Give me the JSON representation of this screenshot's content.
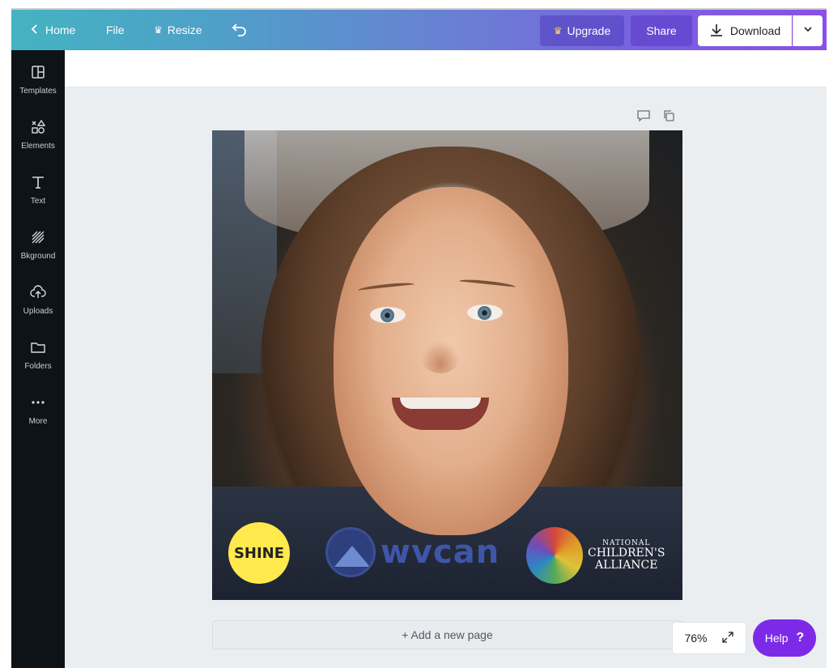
{
  "topbar": {
    "home_label": "Home",
    "file_label": "File",
    "resize_label": "Resize",
    "upgrade_label": "Upgrade",
    "share_label": "Share",
    "download_label": "Download"
  },
  "sidebar": {
    "items": [
      {
        "label": "Templates",
        "icon": "templates-icon"
      },
      {
        "label": "Elements",
        "icon": "elements-icon"
      },
      {
        "label": "Text",
        "icon": "text-icon"
      },
      {
        "label": "Bkground",
        "icon": "background-icon"
      },
      {
        "label": "Uploads",
        "icon": "uploads-icon"
      },
      {
        "label": "Folders",
        "icon": "folder-icon"
      },
      {
        "label": "More",
        "icon": "more-icon"
      }
    ]
  },
  "design": {
    "logos": {
      "shine": "SHINE",
      "wvcan": "wvcan",
      "nca_line1": "NATIONAL",
      "nca_line2": "CHILDREN'S",
      "nca_line3": "ALLIANCE"
    }
  },
  "canvas": {
    "add_page_label": "+ Add a new page"
  },
  "footer": {
    "zoom_label": "76%",
    "help_label": "Help",
    "help_icon_text": "?"
  },
  "colors": {
    "accent": "#7d2ae8",
    "sidebar_bg": "#0e1318",
    "canvas_bg": "#ebeef1"
  }
}
